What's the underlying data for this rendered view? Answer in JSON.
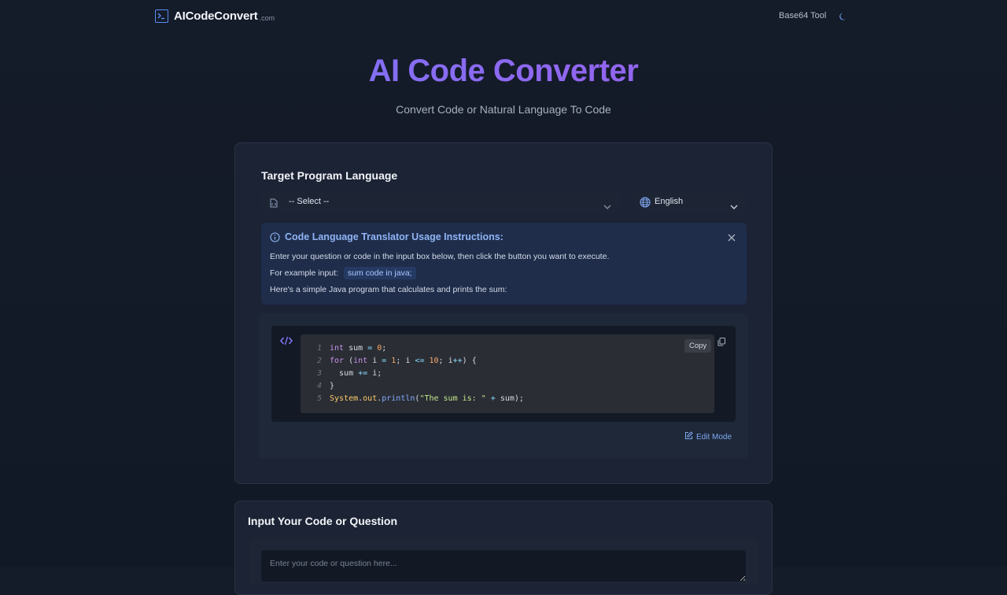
{
  "header": {
    "logo_name": "AICodeConvert",
    "logo_suffix": ".com",
    "nav_link": "Base64 Tool",
    "theme_toggle_icon": "moon-icon"
  },
  "hero": {
    "title": "AI Code Converter",
    "subtitle": "Convert Code or Natural Language To Code"
  },
  "target": {
    "title": "Target Program Language",
    "language_select": {
      "value": "-- Select --",
      "icon": "file-code-icon"
    },
    "ui_language_select": {
      "value": "English",
      "icon": "globe-icon"
    }
  },
  "notice": {
    "title": "Code Language Translator Usage Instructions:",
    "line1": "Enter your question or code in the input box below, then click the button you want to execute.",
    "example_prefix": "For example input:",
    "example_code": "sum code in java;",
    "line3": "Here's a simple Java program that calculates and prints the sum:"
  },
  "code_preview": {
    "copy_label": "Copy",
    "line_numbers": [
      "1",
      "2",
      "3",
      "4",
      "5"
    ],
    "edit_mode_label": "Edit Mode"
  },
  "input_section": {
    "title": "Input Your Code or Question",
    "placeholder": "Enter your code or question here..."
  },
  "colors": {
    "background": "#131a28",
    "card": "#1b2334",
    "accent": "#5a8df5",
    "title_gradient_start": "#6b7ff7",
    "title_gradient_end": "#a35be8"
  }
}
